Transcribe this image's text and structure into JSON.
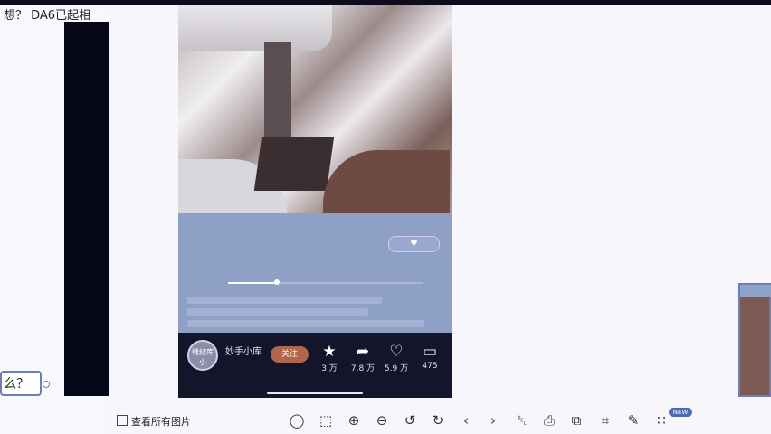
{
  "left_panel": {
    "title_text": "想？ DA6已起相",
    "bubble_text": "么？"
  },
  "post": {
    "caption": "",
    "like_pill_text": "",
    "progress": 0.25,
    "author_name": "妙手小库",
    "author_sub": "",
    "avatar_text": "缝纫库小",
    "follow_label": "关注",
    "actions": [
      {
        "icon": "star-icon",
        "glyph": "★",
        "count": "3 万"
      },
      {
        "icon": "share-icon",
        "glyph": "➦",
        "count": "7.8 万"
      },
      {
        "icon": "heart-icon",
        "glyph": "♡",
        "count": "5.9 万"
      },
      {
        "icon": "comment-icon",
        "glyph": "▭",
        "count": "475"
      }
    ]
  },
  "toolbar": {
    "view_all_label": "查看所有图片",
    "new_badge": "NEW",
    "icons": [
      {
        "name": "mouse-mode-icon",
        "glyph": "◯"
      },
      {
        "name": "fit-screen-icon",
        "glyph": "⬚"
      },
      {
        "name": "zoom-in-icon",
        "glyph": "⊕"
      },
      {
        "name": "zoom-out-icon",
        "glyph": "⊖"
      },
      {
        "name": "rotate-left-icon",
        "glyph": "↺"
      },
      {
        "name": "rotate-right-icon",
        "glyph": "↻"
      },
      {
        "name": "previous-icon",
        "glyph": "‹"
      },
      {
        "name": "next-icon",
        "glyph": "›"
      },
      {
        "name": "delete-icon",
        "glyph": "␡"
      },
      {
        "name": "print-icon",
        "glyph": "⎙"
      },
      {
        "name": "copy-icon",
        "glyph": "⧉"
      },
      {
        "name": "crop-icon",
        "glyph": "⌗"
      },
      {
        "name": "edit-icon",
        "glyph": "✎"
      },
      {
        "name": "more-tools-icon",
        "glyph": "∷"
      }
    ]
  },
  "colors": {
    "accent": "#6a7fb6",
    "follow_button": "#b0664a",
    "overlay": "#8ea0c6"
  }
}
